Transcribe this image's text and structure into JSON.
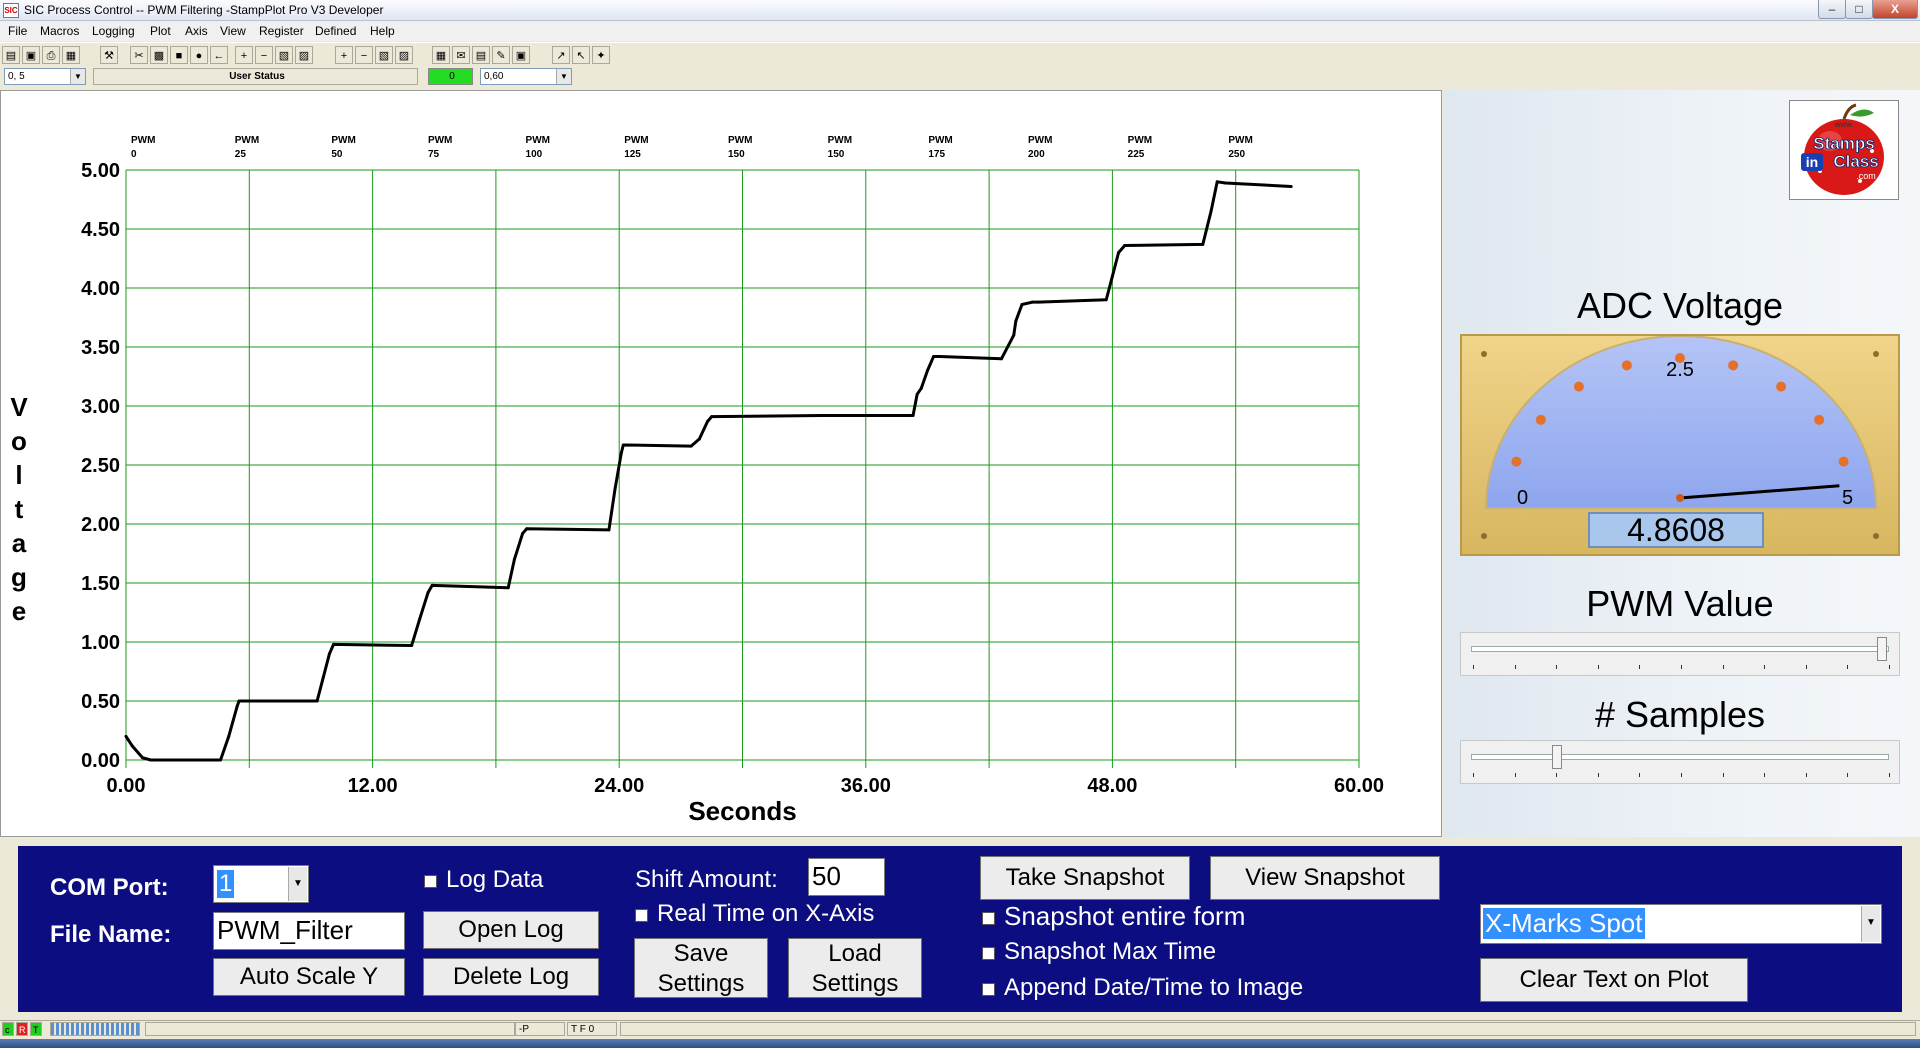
{
  "window": {
    "title": "SIC Process Control -- PWM Filtering  -StampPlot Pro V3 Developer",
    "icon_text": "SIC",
    "min_glyph": "–",
    "max_glyph": "□",
    "close_glyph": "X"
  },
  "menu": [
    "File",
    "Macros",
    "Logging",
    "Plot",
    "Axis",
    "View",
    "Register",
    "Defined",
    "Help"
  ],
  "toolbar_glyphs": [
    "▤",
    "▣",
    "⎙",
    "▦",
    "⚒",
    "✂",
    "▩",
    "■",
    "●",
    "←",
    "+",
    "−",
    "▧",
    "▨",
    "+",
    "−",
    "▧",
    "▨",
    "▦",
    "✉",
    "▤",
    "✎",
    "▣",
    "↗",
    "↖",
    "✦"
  ],
  "status_row": {
    "left_select": "0, 5",
    "user_status": "User Status",
    "indicator": "0",
    "right_select": "0,60"
  },
  "plot": {
    "ylabel": "Voltage",
    "xlabel": "Seconds",
    "markers": [
      {
        "t": 0,
        "label1": "PWM",
        "label2": "0"
      },
      {
        "t": 5.05,
        "label1": "PWM",
        "label2": "25"
      },
      {
        "t": 9.75,
        "label1": "PWM",
        "label2": "50"
      },
      {
        "t": 14.45,
        "label1": "PWM",
        "label2": "75"
      },
      {
        "t": 19.2,
        "label1": "PWM",
        "label2": "100"
      },
      {
        "t": 24.0,
        "label1": "PWM",
        "label2": "125"
      },
      {
        "t": 29.05,
        "label1": "PWM",
        "label2": "150"
      },
      {
        "t": 33.9,
        "label1": "PWM",
        "label2": "150"
      },
      {
        "t": 38.8,
        "label1": "PWM",
        "label2": "175"
      },
      {
        "t": 43.65,
        "label1": "PWM",
        "label2": "200"
      },
      {
        "t": 48.5,
        "label1": "PWM",
        "label2": "225"
      },
      {
        "t": 53.4,
        "label1": "PWM",
        "label2": "250"
      }
    ]
  },
  "chart_data": {
    "type": "line",
    "xlabel": "Seconds",
    "ylabel": "Voltage",
    "xlim": [
      0,
      60
    ],
    "ylim": [
      0,
      5
    ],
    "xticks": [
      "0.00",
      "12.00",
      "24.00",
      "36.00",
      "48.00",
      "60.00"
    ],
    "yticks": [
      "0.00",
      "0.50",
      "1.00",
      "1.50",
      "2.00",
      "2.50",
      "3.00",
      "3.50",
      "4.00",
      "4.50",
      "5.00"
    ],
    "grid": true,
    "series": [
      {
        "x": [
          0,
          0.3,
          0.8,
          1.2,
          4.6,
          5.0,
          5.4,
          5.5,
          9.3,
          9.6,
          9.9,
          10.1,
          13.9,
          14.3,
          14.7,
          14.9,
          18.6,
          18.9,
          19.3,
          19.5,
          23.5,
          23.8,
          24.1,
          24.2,
          27.5,
          27.9,
          28.3,
          28.5,
          33.9,
          38.3,
          38.5,
          38.7,
          39.0,
          39.3,
          39.6,
          42.6,
          43.2,
          43.3,
          43.6,
          44.1,
          44.4,
          47.7,
          48.0,
          48.3,
          48.6,
          52.4,
          52.8,
          53.1,
          53.5,
          56.7
        ],
        "y": [
          0.2,
          0.12,
          0.02,
          0.0,
          0.0,
          0.2,
          0.45,
          0.5,
          0.5,
          0.7,
          0.9,
          0.98,
          0.97,
          1.2,
          1.42,
          1.48,
          1.46,
          1.7,
          1.92,
          1.96,
          1.95,
          2.3,
          2.6,
          2.67,
          2.66,
          2.72,
          2.87,
          2.91,
          2.92,
          2.92,
          3.1,
          3.15,
          3.3,
          3.42,
          3.42,
          3.4,
          3.6,
          3.72,
          3.86,
          3.88,
          3.88,
          3.9,
          4.1,
          4.3,
          4.36,
          4.37,
          4.65,
          4.9,
          4.89,
          4.86
        ]
      }
    ]
  },
  "right_panel": {
    "adc_title": "ADC Voltage",
    "meter_min": "0",
    "meter_mid": "2.5",
    "meter_max": "5",
    "meter_value": "4.8608",
    "meter_numeric": 4.8608,
    "pwm_title": "PWM Value",
    "pwm_level": 0.98,
    "samples_title": "# Samples",
    "samples_level": 0.2,
    "logo_text": [
      "Stamps",
      "in",
      "Class",
      ".com"
    ]
  },
  "controls": {
    "com_port_label": "COM Port:",
    "com_port_value": "1",
    "file_name_label": "File Name:",
    "file_name_value": "PWM_Filter",
    "auto_scale": "Auto Scale Y",
    "log_data": "Log Data",
    "open_log": "Open Log",
    "delete_log": "Delete Log",
    "shift_amount_label": "Shift Amount:",
    "shift_amount_value": "50",
    "real_time": "Real Time on X-Axis",
    "save_settings_1": "Save",
    "save_settings_2": "Settings",
    "load_settings_1": "Load",
    "load_settings_2": "Settings",
    "take_snapshot": "Take Snapshot",
    "view_snapshot": "View Snapshot",
    "snapshot_entire": "Snapshot entire form",
    "snapshot_max": "Snapshot Max Time",
    "append_date": "Append Date/Time to Image",
    "text_select": "X-Marks Spot",
    "clear_text": "Clear Text on Plot"
  },
  "statusbar": {
    "led1": "c",
    "led2": "R",
    "led3": "T",
    "cell_p": "-P",
    "cell_tf": "T F 0"
  }
}
